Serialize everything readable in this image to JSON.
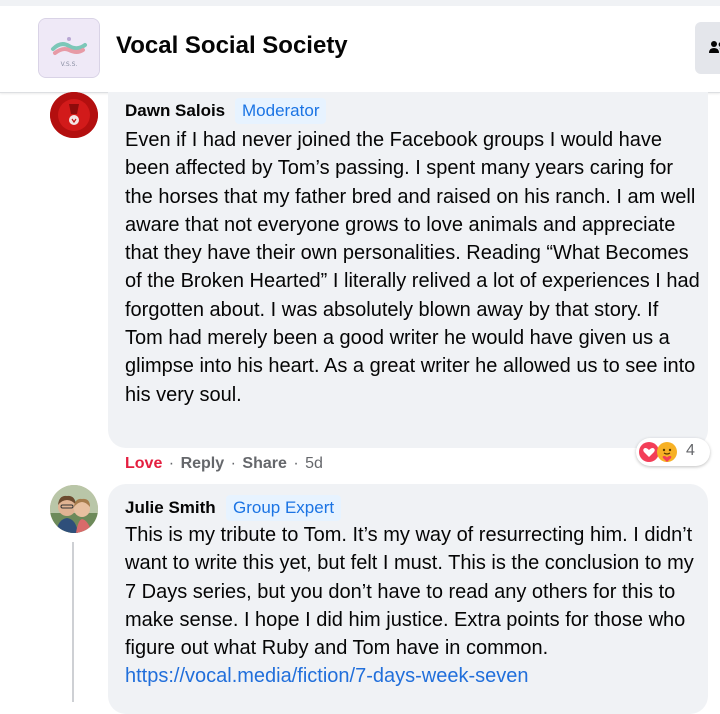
{
  "group": {
    "name": "Vocal Social Society",
    "logo_text": "V.S.S."
  },
  "comments": [
    {
      "author": "Dawn Salois",
      "badge": "Moderator",
      "text": "Even if I had never joined the Facebook groups I would have been affected by Tom’s passing. I spent many years caring for the horses that my father bred and raised on his ranch. I am well aware that not everyone grows to love animals and appreciate that they have their own personalities. Reading “What Becomes of the Broken Hearted” I literally relived a lot of experiences I had forgotten about. I was absolutely blown away by that story. If Tom had merely been a good writer he would have given us a glimpse into his heart. As a great writer he allowed us to see into his very soul.",
      "actions": {
        "love": "Love",
        "reply": "Reply",
        "share": "Share",
        "age": "5d",
        "separator": "·"
      },
      "reactions": {
        "types": [
          "love",
          "care"
        ],
        "count": "4"
      }
    },
    {
      "author": "Julie Smith",
      "badge": "Group Expert",
      "text": "This is my tribute to Tom. It’s my way of resurrecting him. I didn’t want to write this yet, but felt I must. This is the conclusion to my 7 Days series, but you don’t have to read any others for this to make sense. I hope I did him justice. Extra points for those who figure out what Ruby and Tom have in common. ",
      "link": "https://vocal.media/fiction/7-days-week-seven"
    }
  ],
  "colors": {
    "bubble": "#f0f2f5",
    "badge_text": "#1b74e4",
    "badge_bg": "#e7f3ff",
    "love": "#e41e3f",
    "meta": "#65676b",
    "link": "#216fdb"
  },
  "icons": {
    "members": "people-icon",
    "reaction_love": "love-reaction-icon",
    "reaction_care": "care-reaction-icon"
  }
}
